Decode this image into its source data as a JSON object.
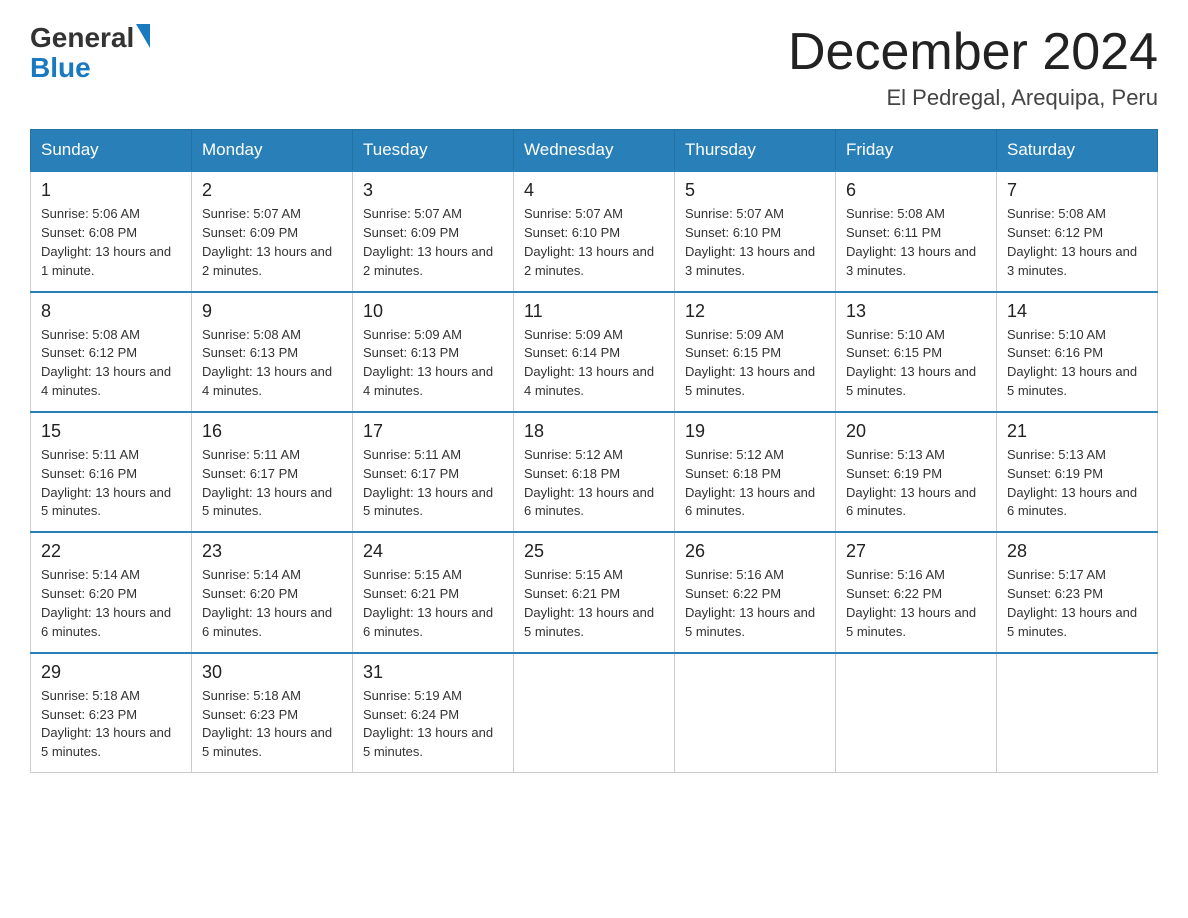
{
  "logo": {
    "general": "General",
    "blue": "Blue"
  },
  "title": "December 2024",
  "subtitle": "El Pedregal, Arequipa, Peru",
  "days_header": [
    "Sunday",
    "Monday",
    "Tuesday",
    "Wednesday",
    "Thursday",
    "Friday",
    "Saturday"
  ],
  "weeks": [
    [
      {
        "num": "1",
        "sunrise": "5:06 AM",
        "sunset": "6:08 PM",
        "daylight": "13 hours and 1 minute."
      },
      {
        "num": "2",
        "sunrise": "5:07 AM",
        "sunset": "6:09 PM",
        "daylight": "13 hours and 2 minutes."
      },
      {
        "num": "3",
        "sunrise": "5:07 AM",
        "sunset": "6:09 PM",
        "daylight": "13 hours and 2 minutes."
      },
      {
        "num": "4",
        "sunrise": "5:07 AM",
        "sunset": "6:10 PM",
        "daylight": "13 hours and 2 minutes."
      },
      {
        "num": "5",
        "sunrise": "5:07 AM",
        "sunset": "6:10 PM",
        "daylight": "13 hours and 3 minutes."
      },
      {
        "num": "6",
        "sunrise": "5:08 AM",
        "sunset": "6:11 PM",
        "daylight": "13 hours and 3 minutes."
      },
      {
        "num": "7",
        "sunrise": "5:08 AM",
        "sunset": "6:12 PM",
        "daylight": "13 hours and 3 minutes."
      }
    ],
    [
      {
        "num": "8",
        "sunrise": "5:08 AM",
        "sunset": "6:12 PM",
        "daylight": "13 hours and 4 minutes."
      },
      {
        "num": "9",
        "sunrise": "5:08 AM",
        "sunset": "6:13 PM",
        "daylight": "13 hours and 4 minutes."
      },
      {
        "num": "10",
        "sunrise": "5:09 AM",
        "sunset": "6:13 PM",
        "daylight": "13 hours and 4 minutes."
      },
      {
        "num": "11",
        "sunrise": "5:09 AM",
        "sunset": "6:14 PM",
        "daylight": "13 hours and 4 minutes."
      },
      {
        "num": "12",
        "sunrise": "5:09 AM",
        "sunset": "6:15 PM",
        "daylight": "13 hours and 5 minutes."
      },
      {
        "num": "13",
        "sunrise": "5:10 AM",
        "sunset": "6:15 PM",
        "daylight": "13 hours and 5 minutes."
      },
      {
        "num": "14",
        "sunrise": "5:10 AM",
        "sunset": "6:16 PM",
        "daylight": "13 hours and 5 minutes."
      }
    ],
    [
      {
        "num": "15",
        "sunrise": "5:11 AM",
        "sunset": "6:16 PM",
        "daylight": "13 hours and 5 minutes."
      },
      {
        "num": "16",
        "sunrise": "5:11 AM",
        "sunset": "6:17 PM",
        "daylight": "13 hours and 5 minutes."
      },
      {
        "num": "17",
        "sunrise": "5:11 AM",
        "sunset": "6:17 PM",
        "daylight": "13 hours and 5 minutes."
      },
      {
        "num": "18",
        "sunrise": "5:12 AM",
        "sunset": "6:18 PM",
        "daylight": "13 hours and 6 minutes."
      },
      {
        "num": "19",
        "sunrise": "5:12 AM",
        "sunset": "6:18 PM",
        "daylight": "13 hours and 6 minutes."
      },
      {
        "num": "20",
        "sunrise": "5:13 AM",
        "sunset": "6:19 PM",
        "daylight": "13 hours and 6 minutes."
      },
      {
        "num": "21",
        "sunrise": "5:13 AM",
        "sunset": "6:19 PM",
        "daylight": "13 hours and 6 minutes."
      }
    ],
    [
      {
        "num": "22",
        "sunrise": "5:14 AM",
        "sunset": "6:20 PM",
        "daylight": "13 hours and 6 minutes."
      },
      {
        "num": "23",
        "sunrise": "5:14 AM",
        "sunset": "6:20 PM",
        "daylight": "13 hours and 6 minutes."
      },
      {
        "num": "24",
        "sunrise": "5:15 AM",
        "sunset": "6:21 PM",
        "daylight": "13 hours and 6 minutes."
      },
      {
        "num": "25",
        "sunrise": "5:15 AM",
        "sunset": "6:21 PM",
        "daylight": "13 hours and 5 minutes."
      },
      {
        "num": "26",
        "sunrise": "5:16 AM",
        "sunset": "6:22 PM",
        "daylight": "13 hours and 5 minutes."
      },
      {
        "num": "27",
        "sunrise": "5:16 AM",
        "sunset": "6:22 PM",
        "daylight": "13 hours and 5 minutes."
      },
      {
        "num": "28",
        "sunrise": "5:17 AM",
        "sunset": "6:23 PM",
        "daylight": "13 hours and 5 minutes."
      }
    ],
    [
      {
        "num": "29",
        "sunrise": "5:18 AM",
        "sunset": "6:23 PM",
        "daylight": "13 hours and 5 minutes."
      },
      {
        "num": "30",
        "sunrise": "5:18 AM",
        "sunset": "6:23 PM",
        "daylight": "13 hours and 5 minutes."
      },
      {
        "num": "31",
        "sunrise": "5:19 AM",
        "sunset": "6:24 PM",
        "daylight": "13 hours and 5 minutes."
      },
      null,
      null,
      null,
      null
    ]
  ]
}
